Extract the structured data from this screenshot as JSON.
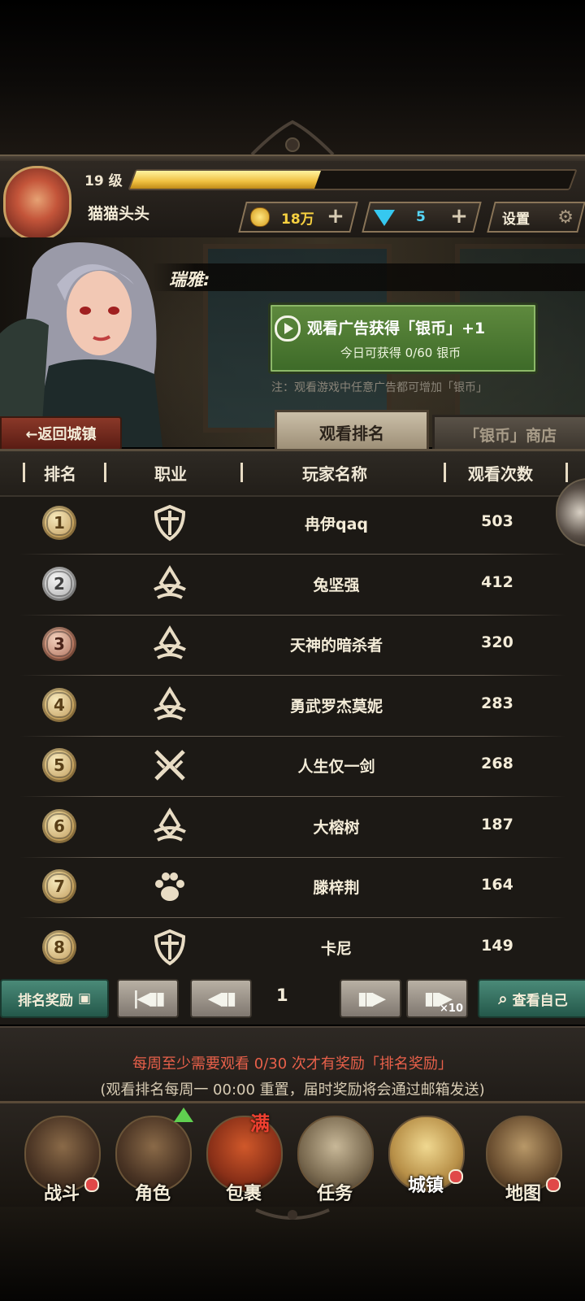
{
  "player": {
    "level": "19 级",
    "xp_fraction": 0.42,
    "name": "猫猫头头"
  },
  "resources": {
    "gold": "18万",
    "gems": "5",
    "settings_label": "设置"
  },
  "npc": {
    "name": "瑞雅:"
  },
  "ad": {
    "title": "观看广告获得「银币」+1",
    "subtitle": "今日可获得 0/60 银币",
    "note": "注：观看游戏中任意广告都可增加「银币」"
  },
  "nav_top": {
    "back_label": "←返回城镇",
    "tab_ranking": "观看排名",
    "tab_shop": "「银币」商店"
  },
  "table": {
    "headers": [
      "排名",
      "职业",
      "玩家名称",
      "观看次数"
    ],
    "rows": [
      {
        "rank": "1",
        "job": "shield-cross-icon",
        "name": "冉伊qaq",
        "count": "503"
      },
      {
        "rank": "2",
        "job": "arrow-crest-icon",
        "name": "兔坚强",
        "count": "412"
      },
      {
        "rank": "3",
        "job": "arrow-crest-icon",
        "name": "天神的暗杀者",
        "count": "320"
      },
      {
        "rank": "4",
        "job": "arrow-crest-icon",
        "name": "勇武罗杰莫妮",
        "count": "283"
      },
      {
        "rank": "5",
        "job": "crossed-swords-icon",
        "name": "人生仅一剑",
        "count": "268"
      },
      {
        "rank": "6",
        "job": "arrow-crest-icon",
        "name": "大榕树",
        "count": "187"
      },
      {
        "rank": "7",
        "job": "paw-icon",
        "name": "滕梓荆",
        "count": "164"
      },
      {
        "rank": "8",
        "job": "shield-cross-icon",
        "name": "卡尼",
        "count": "149"
      }
    ]
  },
  "pager": {
    "reward_label": "排名奖励",
    "page": "1",
    "x10_label": "×10",
    "find_self_label": "查看自己"
  },
  "info": {
    "line1": "每周至少需要观看 0/30 次才有奖励「排名奖励」",
    "line2": "(观看排名每周一 00:00 重置，届时奖励将会通过邮箱发送)"
  },
  "bottom_nav": [
    {
      "label": "战斗",
      "dot": true
    },
    {
      "label": "角色",
      "dot": false
    },
    {
      "label": "包裹",
      "dot": false,
      "badge": "满"
    },
    {
      "label": "任务",
      "dot": false
    },
    {
      "label": "城镇",
      "dot": true
    },
    {
      "label": "地图",
      "dot": true
    }
  ],
  "colors": {
    "gold_accent": "#f0c040",
    "ad_green": "#4e7a34",
    "teal_button": "#2f6a5a",
    "warning_red": "#e8604a"
  }
}
